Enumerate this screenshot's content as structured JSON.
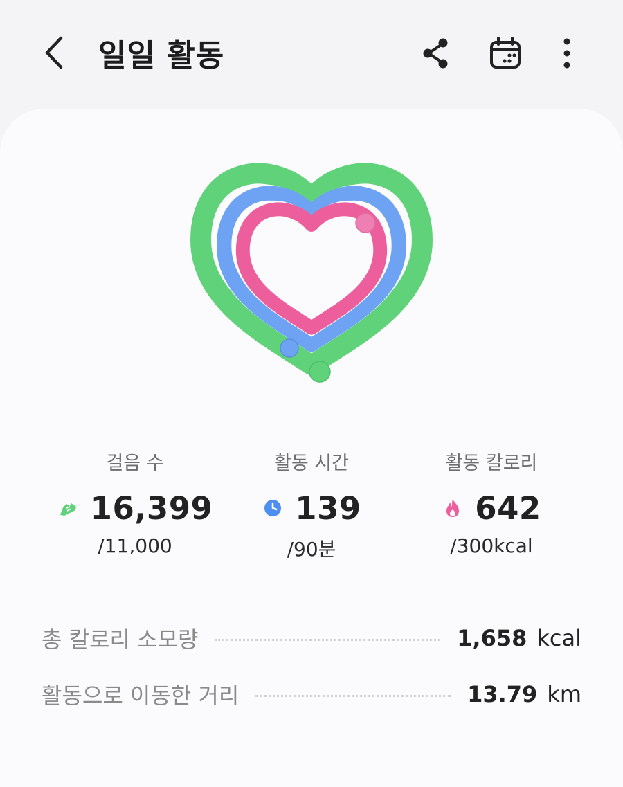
{
  "header": {
    "title": "일일 활동"
  },
  "icons": {
    "back": "back-arrow-icon",
    "share": "share-icon",
    "calendar": "calendar-icon",
    "more": "more-vertical-icon",
    "steps": "shoe-icon",
    "time": "clock-icon",
    "calories": "flame-icon"
  },
  "colors": {
    "steps_ring": "#5fd27a",
    "time_ring": "#6ea2f2",
    "calories_ring": "#ec5f9c"
  },
  "progress": {
    "steps": 1.49,
    "active_time": 1.54,
    "active_calories": 2.14
  },
  "stats": [
    {
      "label": "걸음 수",
      "value": "16,399",
      "goal": "/11,000"
    },
    {
      "label": "활동 시간",
      "value": "139",
      "goal": "/90분"
    },
    {
      "label": "활동 칼로리",
      "value": "642",
      "goal": "/300kcal"
    }
  ],
  "summary": [
    {
      "label": "총 칼로리 소모량",
      "value": "1,658",
      "unit": "kcal"
    },
    {
      "label": "활동으로 이동한 거리",
      "value": "13.79",
      "unit": "km"
    }
  ]
}
